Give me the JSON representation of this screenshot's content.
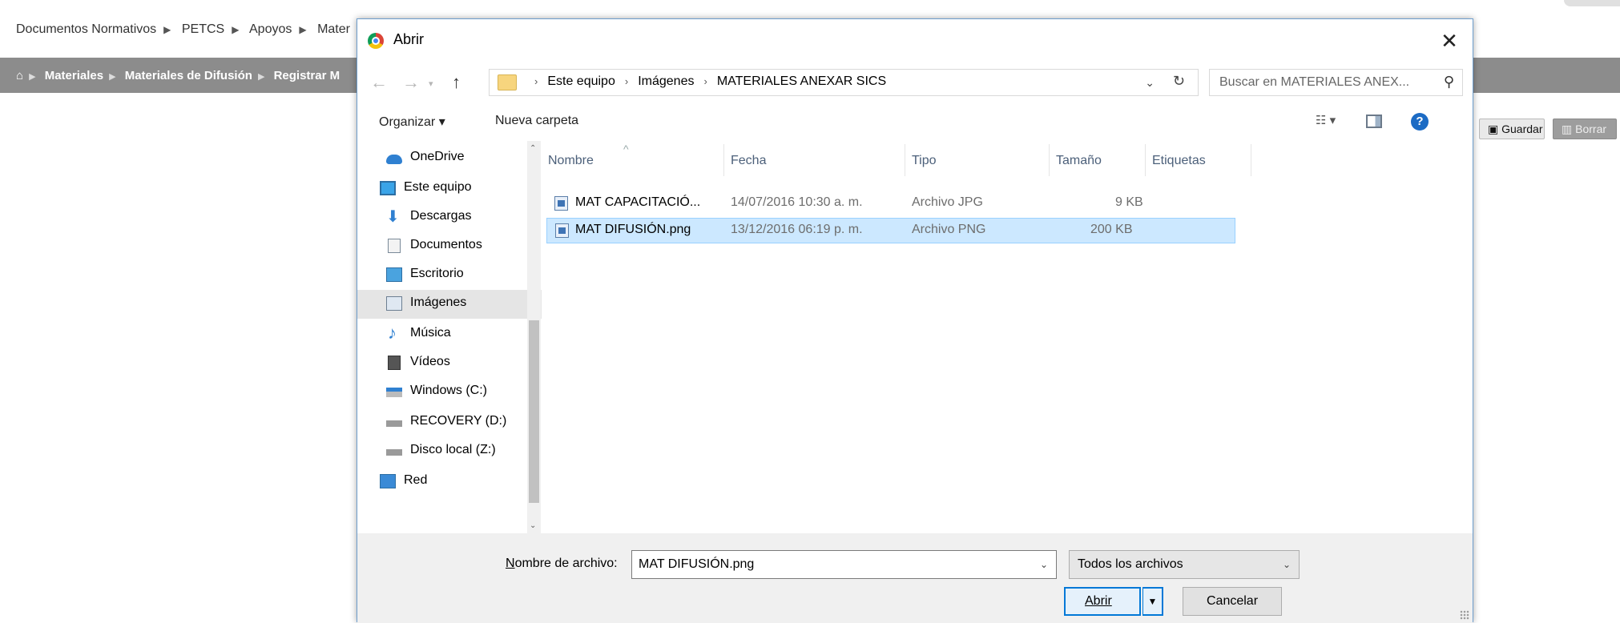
{
  "background": {
    "topnav": [
      "Documentos Normativos",
      "PETCS",
      "Apoyos",
      "Mater"
    ],
    "breadcrumb": [
      "Materiales",
      "Materiales de Difusión",
      "Registrar M"
    ],
    "save_label": "Guardar",
    "delete_label": "Borrar"
  },
  "dialog": {
    "title": "Abrir",
    "address": [
      "Este equipo",
      "Imágenes",
      "MATERIALES ANEXAR SICS"
    ],
    "search_placeholder": "Buscar en MATERIALES ANEX...",
    "toolbar": {
      "organize": "Organizar ▾",
      "new_folder": "Nueva carpeta"
    },
    "nav": [
      {
        "label": "OneDrive",
        "icon": "cloud-icon"
      },
      {
        "label": "Este equipo",
        "icon": "computer-icon"
      },
      {
        "label": "Descargas",
        "icon": "download-icon"
      },
      {
        "label": "Documentos",
        "icon": "document-icon"
      },
      {
        "label": "Escritorio",
        "icon": "desktop-icon"
      },
      {
        "label": "Imágenes",
        "icon": "pictures-icon",
        "selected": true
      },
      {
        "label": "Música",
        "icon": "music-icon"
      },
      {
        "label": "Vídeos",
        "icon": "video-icon"
      },
      {
        "label": "Windows (C:)",
        "icon": "drive-icon"
      },
      {
        "label": "RECOVERY (D:)",
        "icon": "drive-icon"
      },
      {
        "label": "Disco local (Z:)",
        "icon": "drive-icon"
      },
      {
        "label": "Red",
        "icon": "network-icon"
      }
    ],
    "columns": [
      "Nombre",
      "Fecha",
      "Tipo",
      "Tamaño",
      "Etiquetas"
    ],
    "files": [
      {
        "name": "MAT CAPACITACIÓ...",
        "date": "14/07/2016 10:30 a. m.",
        "type": "Archivo JPG",
        "size": "9 KB",
        "selected": false
      },
      {
        "name": "MAT DIFUSIÓN.png",
        "date": "13/12/2016 06:19 p. m.",
        "type": "Archivo PNG",
        "size": "200 KB",
        "selected": true
      }
    ],
    "filename_label_first": "N",
    "filename_label_rest": "ombre de archivo:",
    "filename_value": "MAT DIFUSIÓN.png",
    "filetype_value": "Todos los archivos",
    "open_label": "Abrir",
    "cancel_label": "Cancelar"
  },
  "colors": {
    "accent": "#0078d7",
    "selection": "#cce8ff",
    "breadcrumb_bar": "#8c8c8c"
  }
}
